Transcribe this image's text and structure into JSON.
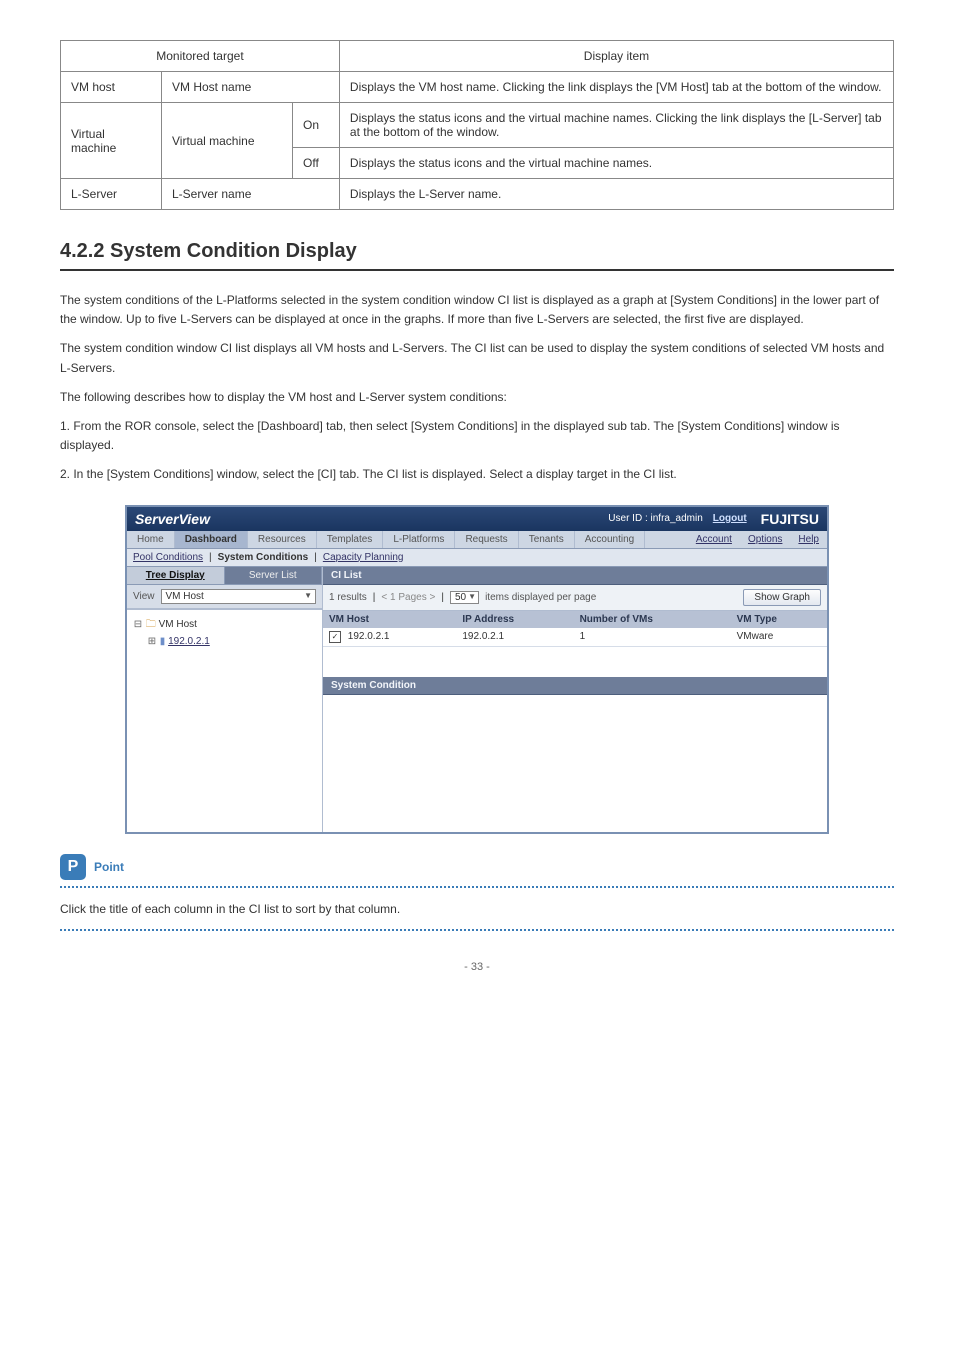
{
  "doc_table": {
    "headers": [
      "Monitored target",
      "Display item"
    ],
    "rows": [
      {
        "target": "VM host",
        "item_cols": [
          "VM Host name"
        ],
        "display": "Displays the VM host name. Clicking the link displays the [VM Host] tab at the bottom of the window."
      },
      {
        "target": "Virtual machine",
        "item_cols": [
          "Virtual machine",
          "On"
        ],
        "display": "Displays the status icons and the virtual machine names. Clicking the link displays the [L-Server] tab at the bottom of the window."
      },
      {
        "target_continued": true,
        "item_cols": [
          "",
          "Off"
        ],
        "display": "Displays the status icons and the virtual machine names."
      },
      {
        "target": "L-Server",
        "item_cols": [
          "L-Server name"
        ],
        "display": "Displays the L-Server name."
      }
    ]
  },
  "section": {
    "number": "4.2.2",
    "title": "System Condition Display"
  },
  "intro_paragraphs": [
    "The system conditions of the L-Platforms selected in the system condition window CI list is displayed as a graph at [System Conditions] in the lower part of the window. Up to five L-Servers can be displayed at once in the graphs. If more than five L-Servers are selected, the first five are displayed.",
    "The system condition window CI list displays all VM hosts and L-Servers. The CI list can be used to display the system conditions of selected VM hosts and L-Servers.",
    "The following describes how to display the VM host and L-Server system conditions:",
    "1. From the ROR console, select the [Dashboard] tab, then select [System Conditions] in the displayed sub tab. The [System Conditions] window is displayed.",
    "2. In the [System Conditions] window, select the [CI] tab. The CI list is displayed. Select a display target in the CI list."
  ],
  "screenshot": {
    "header": {
      "brand": "ServerView",
      "user_id_label": "User ID :",
      "user_id": "infra_admin",
      "logout": "Logout",
      "fujitsu": "FUJITSU"
    },
    "tabs": [
      "Home",
      "Dashboard",
      "Resources",
      "Templates",
      "L-Platforms",
      "Requests",
      "Tenants",
      "Accounting"
    ],
    "tabs_active": "Dashboard",
    "right_links": [
      "Account",
      "Options",
      "Help"
    ],
    "subtabs": [
      "Pool Conditions",
      "System Conditions",
      "Capacity Planning"
    ],
    "subtabs_active": "System Conditions",
    "left": {
      "tabs": [
        "Tree Display",
        "Server List"
      ],
      "active_tab": "Tree Display",
      "view_label": "View",
      "view_value": "VM Host",
      "tree_root": "VM Host",
      "tree_child": "192.0.2.1"
    },
    "ci_list": {
      "title": "CI List",
      "results": "1 results",
      "pager": "< 1 Pages >",
      "per_page_value": "50",
      "per_page_label": "items displayed per page",
      "show_graph": "Show Graph",
      "columns": [
        "VM Host",
        "IP Address",
        "Number of VMs",
        "VM Type"
      ],
      "rows": [
        {
          "checked": true,
          "vm_host": "192.0.2.1",
          "ip": "192.0.2.1",
          "num_vms": "1",
          "vm_type": "VMware"
        }
      ]
    },
    "system_condition_title": "System Condition"
  },
  "point": {
    "label": "Point",
    "text": "Click the title of each column in the CI list to sort by that column."
  },
  "page_number": "- 33 -"
}
